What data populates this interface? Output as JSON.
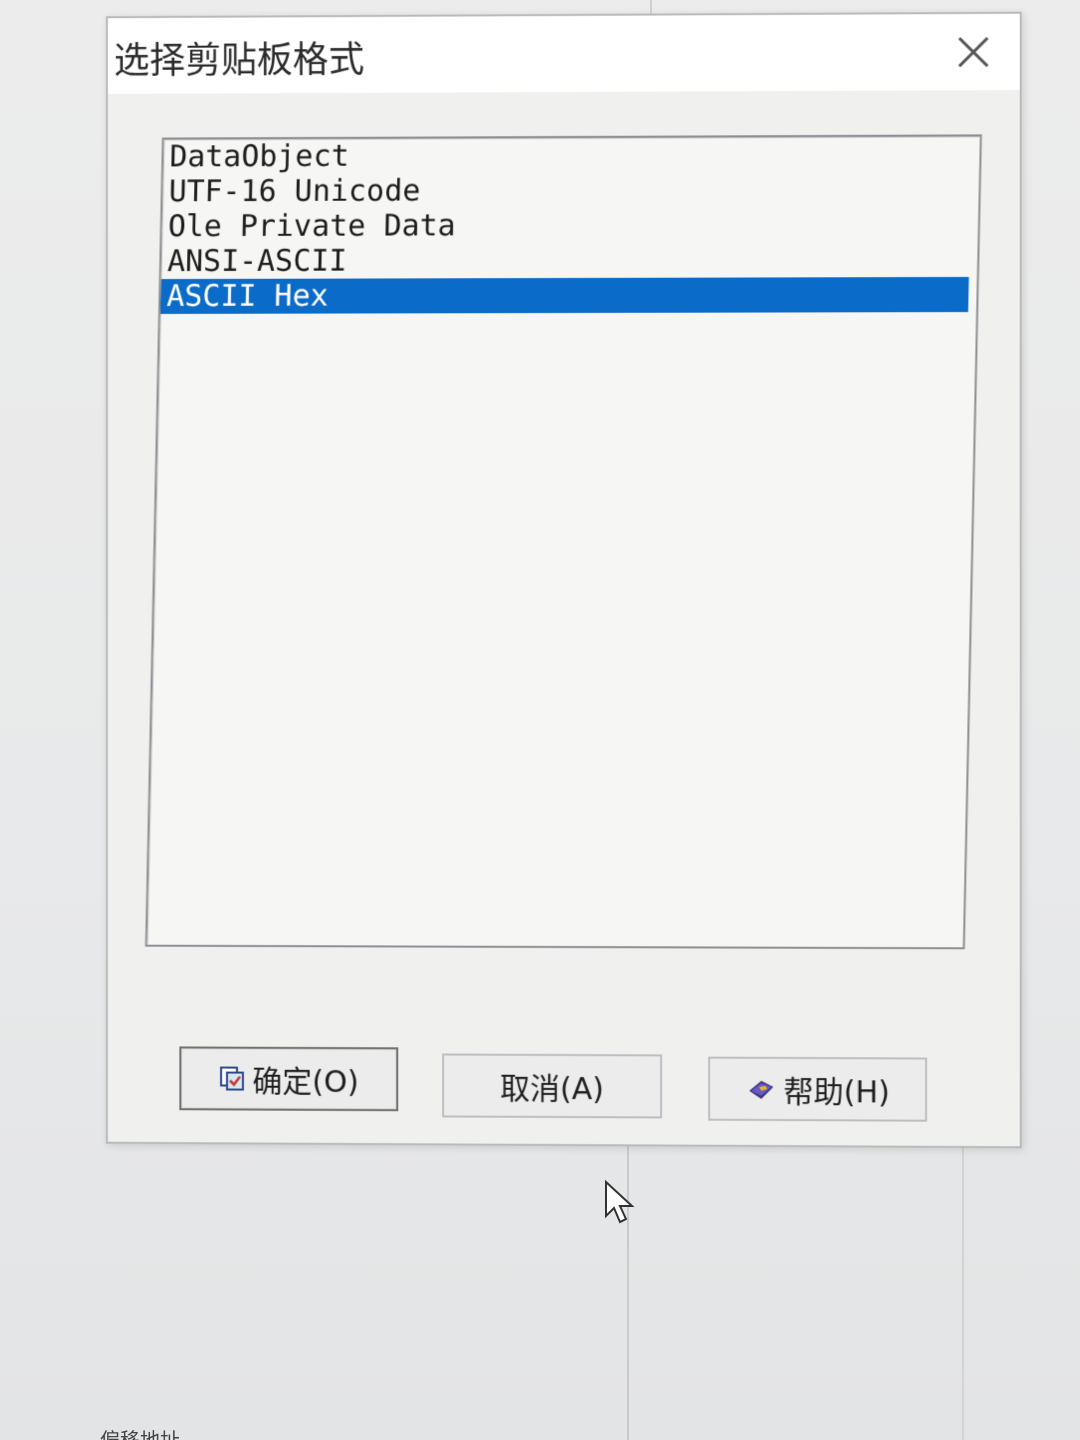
{
  "dialog": {
    "title": "选择剪贴板格式",
    "close_label": "close"
  },
  "list": {
    "items": [
      {
        "label": "DataObject",
        "selected": false
      },
      {
        "label": "UTF-16 Unicode",
        "selected": false
      },
      {
        "label": "Ole Private Data",
        "selected": false
      },
      {
        "label": "ANSI-ASCII",
        "selected": false
      },
      {
        "label": "ASCII Hex",
        "selected": true
      }
    ]
  },
  "buttons": {
    "ok_label": "确定(O)",
    "cancel_label": "取消(A)",
    "help_label": "帮助(H)"
  },
  "background": {
    "bottom_text": "偏移地址"
  },
  "colors": {
    "selection": "#0b6bc9",
    "dialog_bg": "#f0f0ef",
    "list_bg": "#f6f6f4"
  },
  "icons": {
    "ok": "document-check-icon",
    "help": "help-book-icon",
    "close": "close-x-icon",
    "cursor": "mouse-pointer-icon"
  }
}
